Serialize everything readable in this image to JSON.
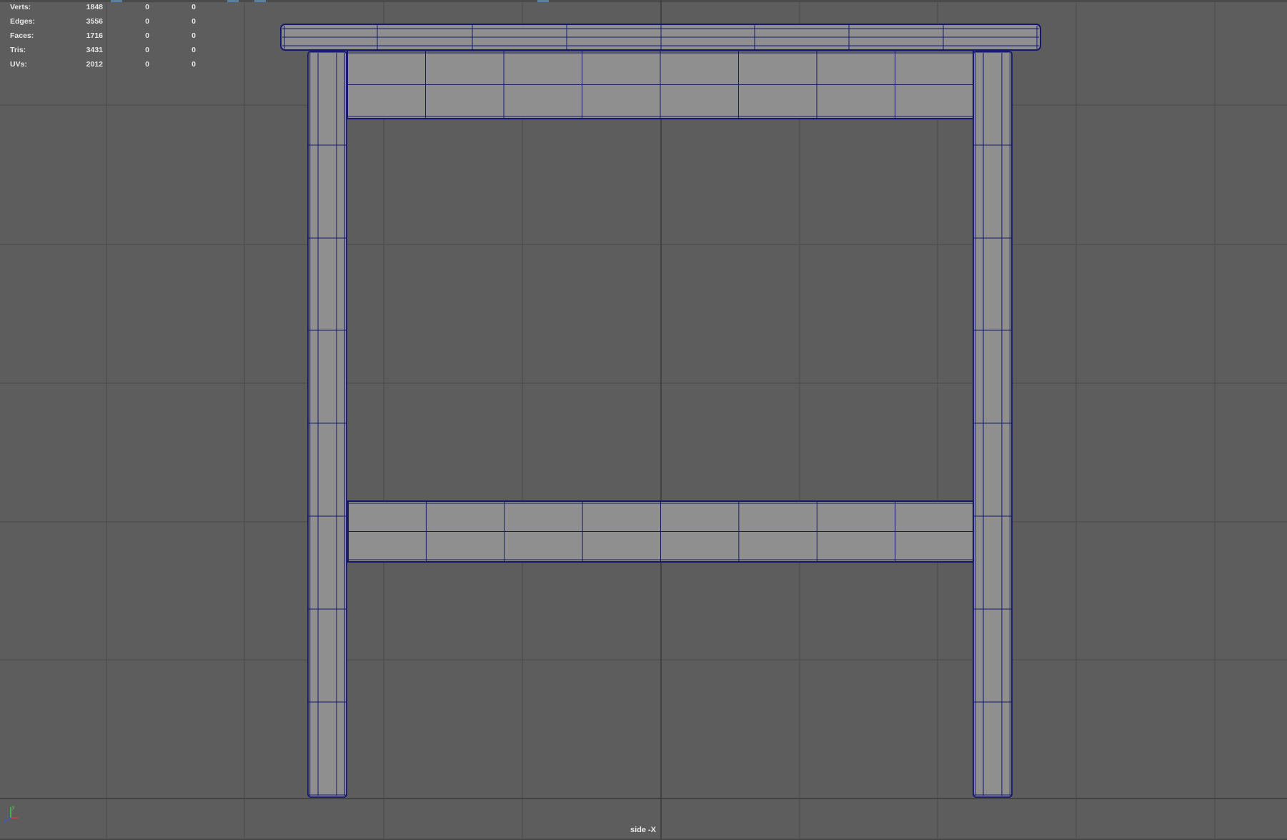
{
  "viewport": {
    "camera_label": "side -X",
    "background_color": "#5d5d5d",
    "grid_color": "#4b4b4b",
    "mesh_face_color": "#8f8f8f",
    "mesh_wire_color": "#16186e"
  },
  "hud": {
    "rows": [
      {
        "label": "Verts:",
        "total": "1848",
        "selected": "0",
        "component": "0"
      },
      {
        "label": "Edges:",
        "total": "3556",
        "selected": "0",
        "component": "0"
      },
      {
        "label": "Faces:",
        "total": "1716",
        "selected": "0",
        "component": "0"
      },
      {
        "label": "Tris:",
        "total": "3431",
        "selected": "0",
        "component": "0"
      },
      {
        "label": "UVs:",
        "total": "2012",
        "selected": "0",
        "component": "0"
      }
    ]
  },
  "axis_gizmo": {
    "x_color": "#d63a3a",
    "y_color": "#3ad63a",
    "z_color": "#3a5ad6",
    "y_label": "y",
    "z_label": "z"
  }
}
